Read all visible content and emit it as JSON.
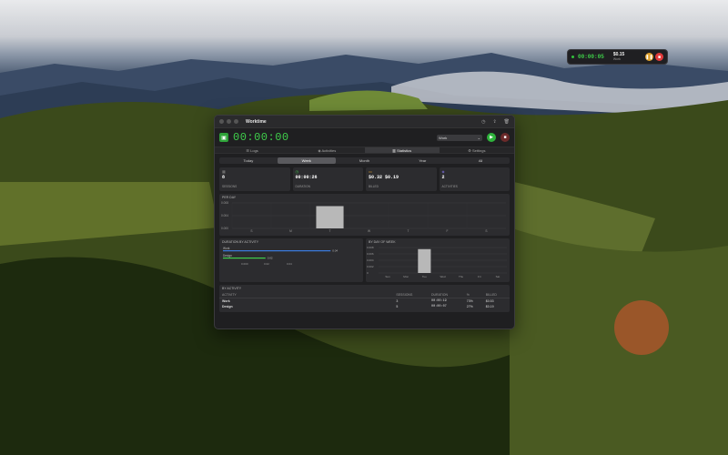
{
  "mini_timer": {
    "time": "00:00:05",
    "earned": "$0.15",
    "earned_label": "Work"
  },
  "app": {
    "title": "Worktime",
    "timer": "00:00:00",
    "mode": "Work",
    "tabs": [
      {
        "label": "Logs"
      },
      {
        "label": "Activities"
      },
      {
        "label": "Statistics",
        "active": true
      },
      {
        "label": "Settings"
      }
    ],
    "periods": [
      {
        "label": "Today"
      },
      {
        "label": "Week",
        "active": true
      },
      {
        "label": "Month"
      },
      {
        "label": "Year"
      },
      {
        "label": "All"
      }
    ],
    "cards": [
      {
        "value": "8",
        "label": "SESSIONS",
        "icon_color": "#8a8a8a"
      },
      {
        "value": "00:00:26",
        "label": "DURATION",
        "icon_color": "#3fcf4b"
      },
      {
        "value": "$0.32 $0.19",
        "label": "BILLED",
        "icon_color": "#e0a02a"
      },
      {
        "value": "2",
        "label": "ACTIVITIES",
        "icon_color": "#7b6cd9"
      }
    ],
    "per_day": {
      "title": "PER DAY",
      "ylabels": [
        "0.008",
        "0.004",
        "0.000"
      ],
      "days": [
        "S",
        "M",
        "T",
        "W",
        "T",
        "F",
        "S"
      ],
      "values": [
        0,
        0,
        0.007,
        0,
        0,
        0,
        0
      ]
    },
    "duration_by_activity": {
      "title": "DURATION BY ACTIVITY",
      "items": [
        {
          "name": "Work",
          "fraction": 0.81,
          "value": "0.04",
          "color": "#3b7be0"
        },
        {
          "name": "Design",
          "fraction": 0.32,
          "value": "0.02",
          "color": "#3fcf4b"
        }
      ],
      "xlabels": [
        "0.000",
        "0.02",
        "0.04"
      ]
    },
    "by_day_of_week": {
      "title": "BY DAY OF WEEK",
      "ylabels": [
        "0.008",
        "0.006",
        "0.004",
        "0.002",
        "0"
      ],
      "days": [
        "Sun",
        "Mon",
        "Tue",
        "Wed",
        "Thu",
        "Fri",
        "Sat"
      ],
      "values": [
        0,
        0,
        0.0075,
        0,
        0,
        0,
        0
      ]
    },
    "by_activity": {
      "title": "BY ACTIVITY",
      "headers": [
        "ACTIVITY",
        "SESSIONS",
        "DURATION",
        "%",
        "BILLED"
      ],
      "rows": [
        {
          "activity": "Work",
          "sessions": "3",
          "duration": "00:00:19",
          "pct": "73%",
          "billed": "$0.53"
        },
        {
          "activity": "Design",
          "sessions": "5",
          "duration": "00:00:07",
          "pct": "27%",
          "billed": "$0.19"
        }
      ]
    }
  }
}
